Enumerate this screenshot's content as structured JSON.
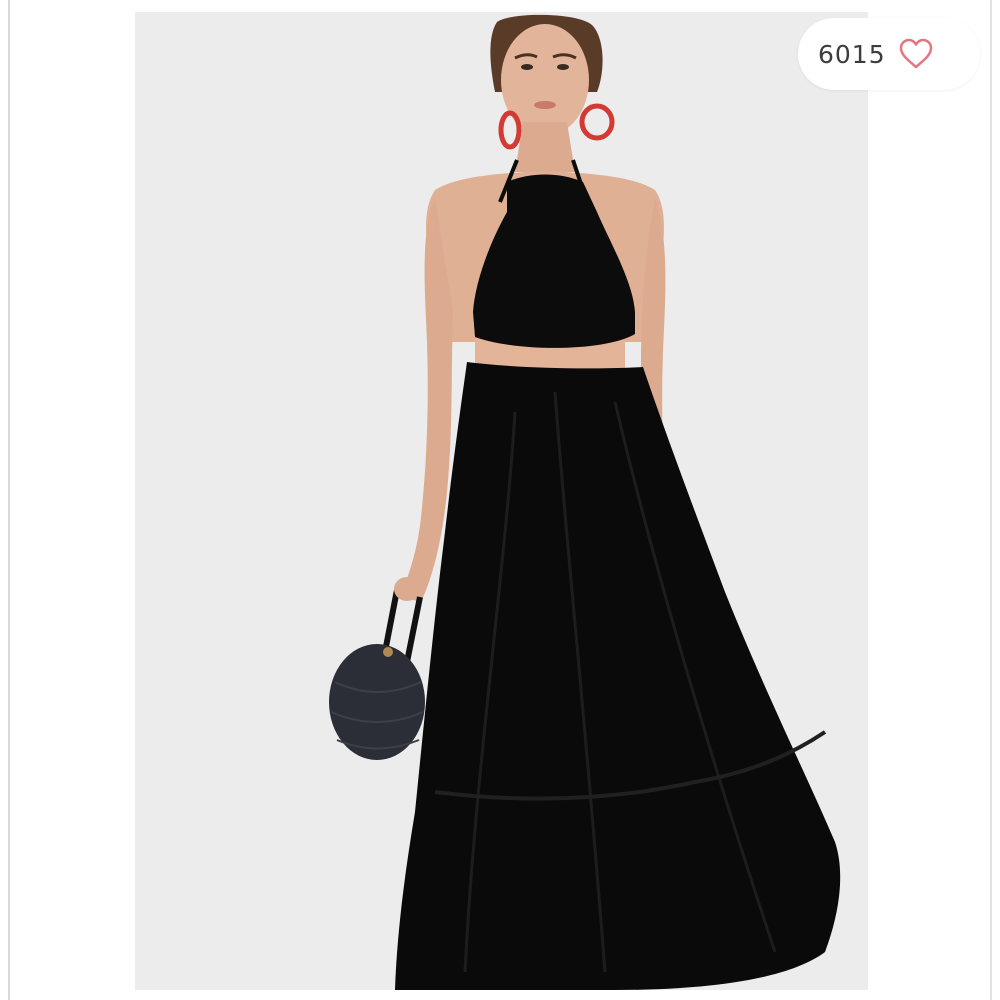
{
  "listing": {
    "photo_alt": "",
    "like_count": "6015",
    "icons": {
      "heart": "heart-outline-icon"
    },
    "colors": {
      "heart": "#e4747f",
      "backdrop": "#ececec",
      "dress": "#0c0c0c"
    }
  }
}
